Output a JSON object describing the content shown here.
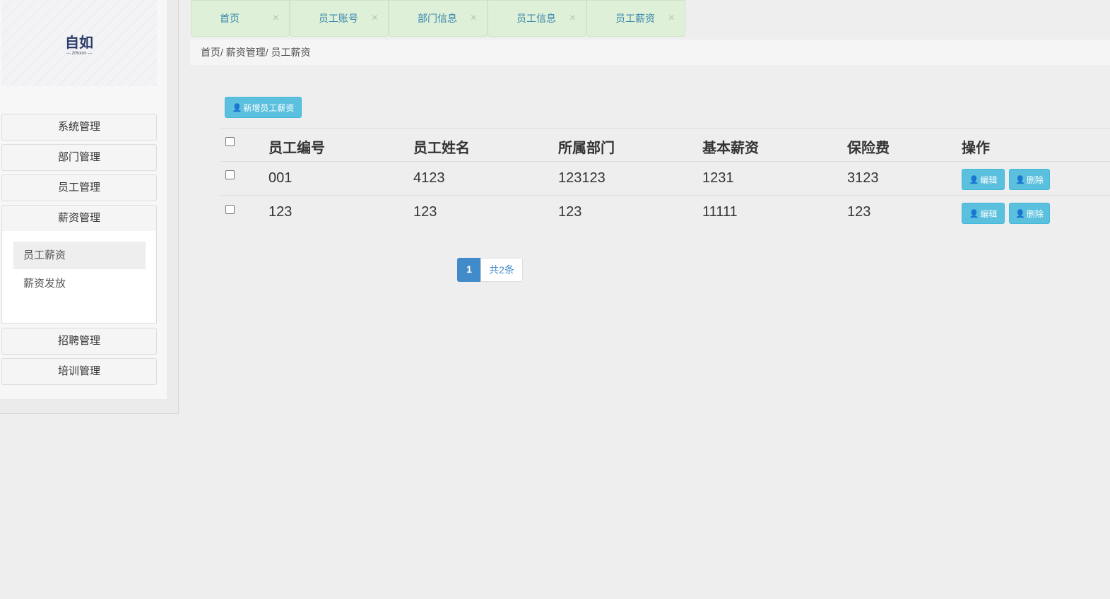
{
  "logo": {
    "name": "自如",
    "sub": "— ZiRoom —"
  },
  "sidebar": {
    "menus": [
      "系统管理",
      "部门管理",
      "员工管理",
      "薪资管理",
      "招聘管理",
      "培训管理"
    ],
    "sub_items": [
      "员工薪资",
      "薪资发放"
    ]
  },
  "tabs": [
    {
      "label": "首页"
    },
    {
      "label": "员工账号"
    },
    {
      "label": "部门信息"
    },
    {
      "label": "员工信息"
    },
    {
      "label": "员工薪资"
    }
  ],
  "tab_close": "×",
  "breadcrumb": "首页/ 薪资管理/ 员工薪资",
  "add_button": "新增员工薪资",
  "table": {
    "headers": [
      "员工编号",
      "员工姓名",
      "所属部门",
      "基本薪资",
      "保险费",
      "操作"
    ],
    "rows": [
      [
        "001",
        "4123",
        "123123",
        "1231",
        "3123"
      ],
      [
        "123",
        "123",
        "123",
        "11111",
        "123"
      ]
    ],
    "edit": "编辑",
    "delete": "删除"
  },
  "pagination": {
    "current": "1",
    "total": "共2条"
  },
  "colors": {
    "info": "#5bc0de",
    "tab": "#dff0d8",
    "page": "#428bca"
  }
}
